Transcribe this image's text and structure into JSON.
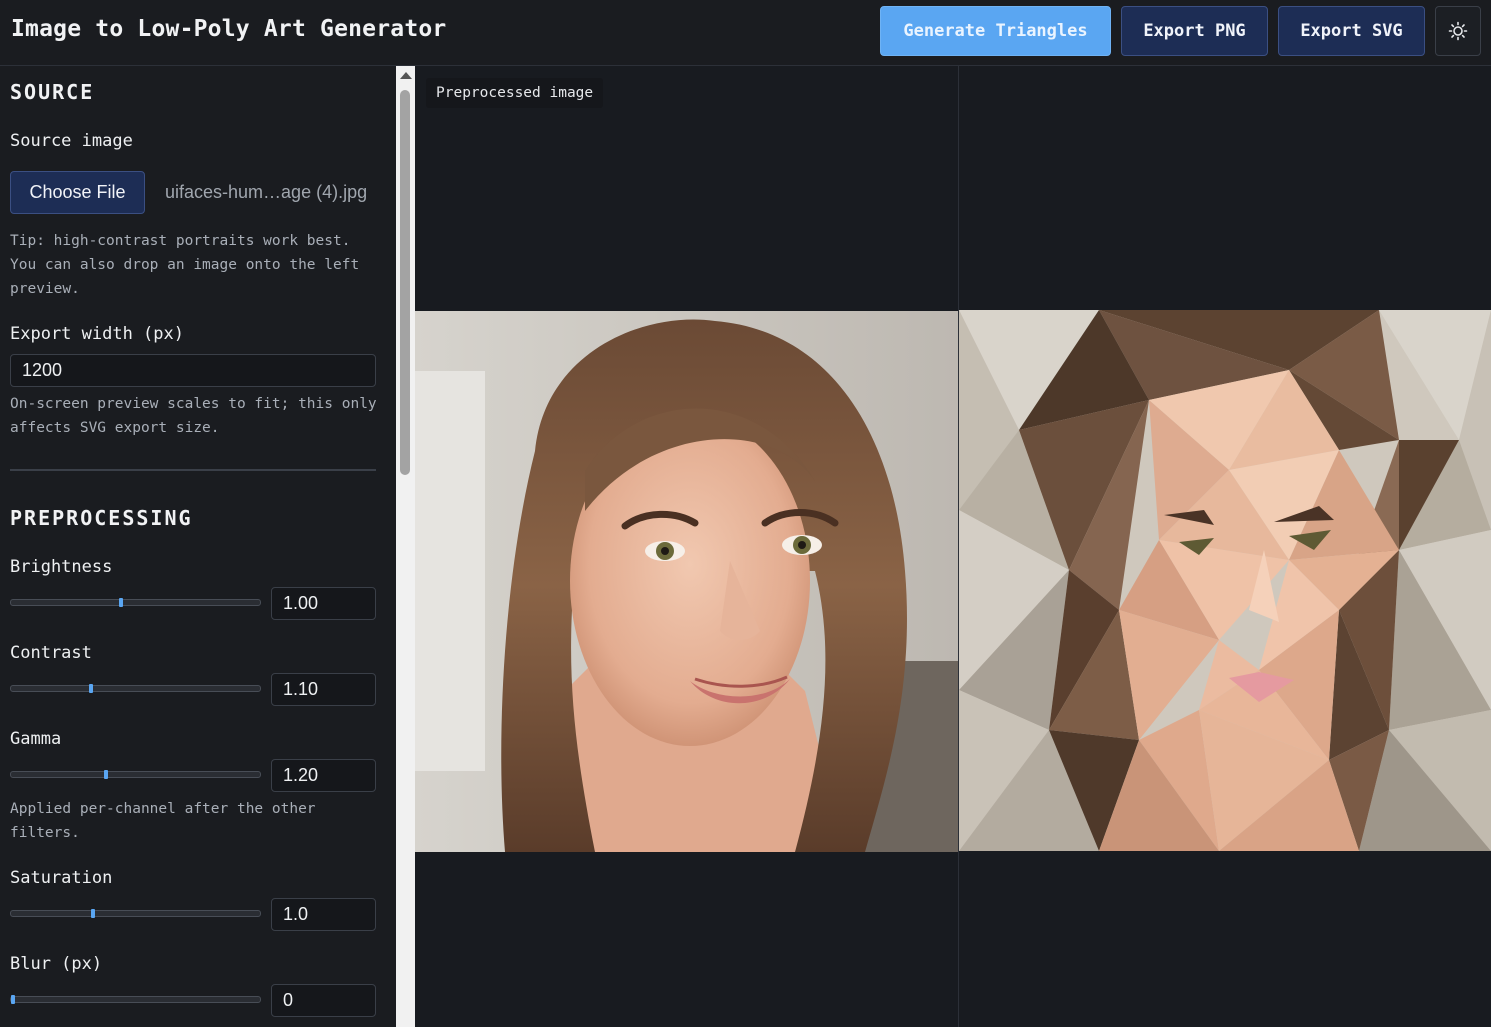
{
  "header": {
    "title": "Image to Low-Poly Art Generator",
    "generate_label": "Generate Triangles",
    "export_png_label": "Export PNG",
    "export_svg_label": "Export SVG",
    "theme_icon": "sun-icon"
  },
  "source": {
    "heading": "SOURCE",
    "image_label": "Source image",
    "choose_file_label": "Choose File",
    "file_name": "uifaces-hum…age (4).jpg",
    "tip": "Tip: high-contrast portraits work best. You can also drop an image onto the left preview.",
    "export_width_label": "Export width (px)",
    "export_width_value": "1200",
    "export_width_hint": "On-screen preview scales to fit; this only affects SVG export size."
  },
  "preprocessing": {
    "heading": "PREPROCESSING",
    "brightness_label": "Brightness",
    "brightness_value": "1.00",
    "brightness_fraction": 0.44,
    "contrast_label": "Contrast",
    "contrast_value": "1.10",
    "contrast_fraction": 0.32,
    "gamma_label": "Gamma",
    "gamma_value": "1.20",
    "gamma_fraction": 0.38,
    "gamma_hint": "Applied per-channel after the other filters.",
    "saturation_label": "Saturation",
    "saturation_value": "1.0",
    "saturation_fraction": 0.33,
    "blur_label": "Blur (px)",
    "blur_value": "0",
    "blur_fraction": 0.0
  },
  "preview": {
    "left_label": "Preprocessed image"
  },
  "colors": {
    "accent": "#5aa6f2",
    "button_dark": "#1d2d55",
    "background": "#181b20"
  }
}
